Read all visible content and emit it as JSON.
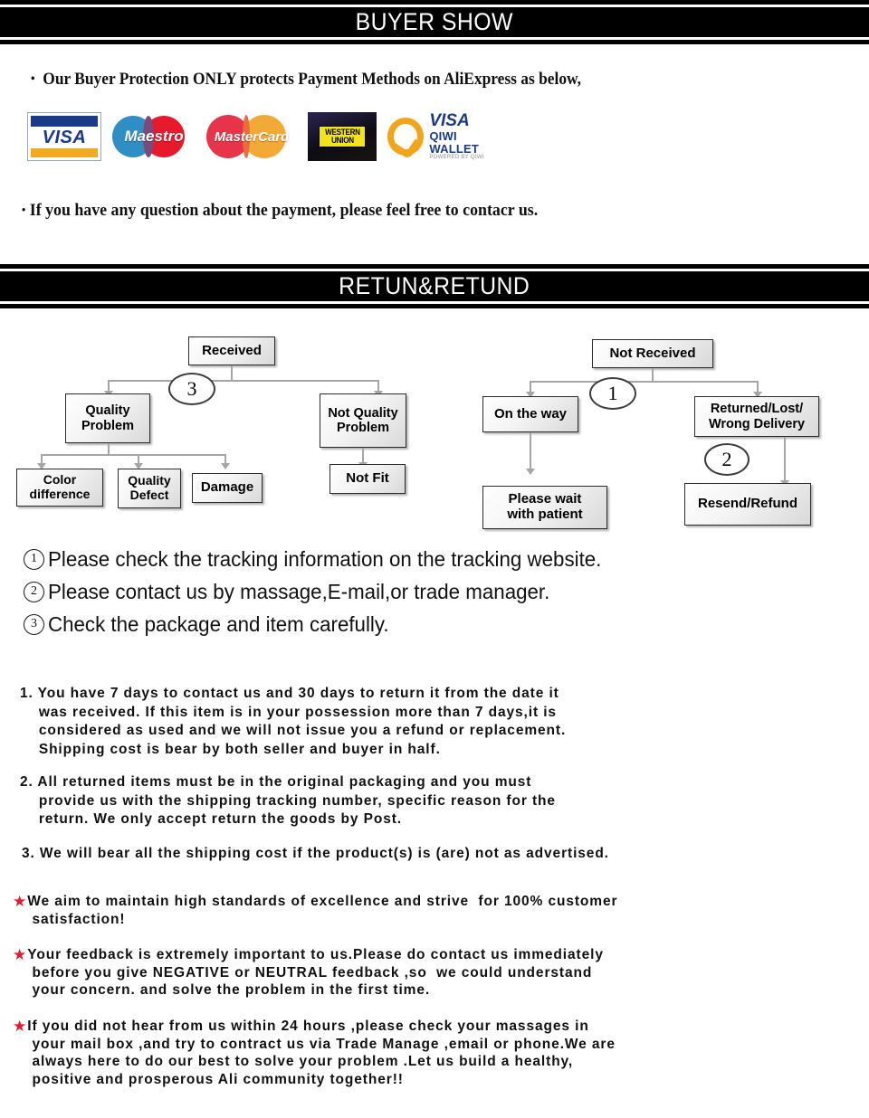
{
  "sections": {
    "buyer_show": {
      "banner_title": "BUYER SHOW",
      "protection_line": "Our Buyer Protection ONLY protects Payment Methods on AliExpress as below,",
      "question_line": "If you have any question about the payment, please feel free to contacr us.",
      "bullet_glyph": "•",
      "payment_logos": [
        {
          "name": "visa-logo",
          "label": "VISA"
        },
        {
          "name": "maestro-logo",
          "label": "Maestro"
        },
        {
          "name": "mastercard-logo",
          "label": "MasterCard"
        },
        {
          "name": "western-union-logo",
          "label_line1": "WESTERN",
          "label_line2": "UNION"
        },
        {
          "name": "qiwi-visa-wallet-logo",
          "visa": "VISA",
          "wallet": "QIWI WALLET",
          "powered": "POWERED BY QIWI"
        }
      ]
    },
    "return_refund": {
      "banner_title": "RETUN&RETUND",
      "flowchart": {
        "nodes": [
          {
            "id": "received",
            "label": "Received"
          },
          {
            "id": "quality-problem",
            "label": "Quality\nProblem"
          },
          {
            "id": "not-quality-problem",
            "label": "Not Quality\nProblem"
          },
          {
            "id": "color-difference",
            "label": "Color\ndifference"
          },
          {
            "id": "quality-defect",
            "label": "Quality\nDefect"
          },
          {
            "id": "damage",
            "label": "Damage"
          },
          {
            "id": "not-fit",
            "label": "Not Fit"
          },
          {
            "id": "not-received",
            "label": "Not  Received"
          },
          {
            "id": "on-the-way",
            "label": "On the way"
          },
          {
            "id": "returned-lost-wrong-delivery",
            "label": "Returned/Lost/\nWrong Delivery"
          },
          {
            "id": "please-wait",
            "label": "Please wait\nwith patient"
          },
          {
            "id": "resend-refund",
            "label": "Resend/Refund"
          }
        ],
        "markers": [
          {
            "id": "marker-3",
            "value": "3"
          },
          {
            "id": "marker-1",
            "value": "1"
          },
          {
            "id": "marker-2",
            "value": "2"
          }
        ]
      },
      "steps": [
        {
          "num": "1",
          "text": "Please check the tracking information on the tracking website."
        },
        {
          "num": "2",
          "text": "Please contact us by  massage,E-mail,or trade manager."
        },
        {
          "num": "3",
          "text": "Check the package and item carefully."
        }
      ],
      "policies": [
        "1. You have 7 days to contact us and 30 days to return it from the date it\n    was received. If this item is in your possession more than 7 days,it is\n    considered as used and we will not issue you a refund or replacement.\n    Shipping cost is bear by both seller and buyer in half.",
        "2. All returned items must be in the original packaging and you must\n    provide us with the shipping tracking number, specific reason for the\n    return. We only accept return the goods by Post.",
        "3. We will bear all the shipping cost if the product(s) is (are) not as advertised."
      ],
      "notes": [
        {
          "star": "★",
          "text": "We aim to maintain high standards of excellence and strive  for 100% customer\n satisfaction!"
        },
        {
          "star": "★",
          "text": "Your feedback is extremely important to us.Please do contact us immediately\n before you give NEGATIVE or NEUTRAL feedback ,so  we could understand\n your concern. and solve the problem in the first time."
        },
        {
          "star": "★",
          "text": "If you did not hear from us within 24 hours ,please check your massages in\n your mail box ,and try to contract us via Trade Manage ,email or phone.We are\n always here to do our best to solve your problem .Let us build a healthy,\n positive and prosperous Ali community together!!"
        }
      ]
    }
  },
  "colors": {
    "banner_bg": "#000000",
    "banner_text": "#ffffff",
    "star": "#e8192c",
    "connector": "#a6a6a6",
    "box_border": "#2b2b2b"
  }
}
